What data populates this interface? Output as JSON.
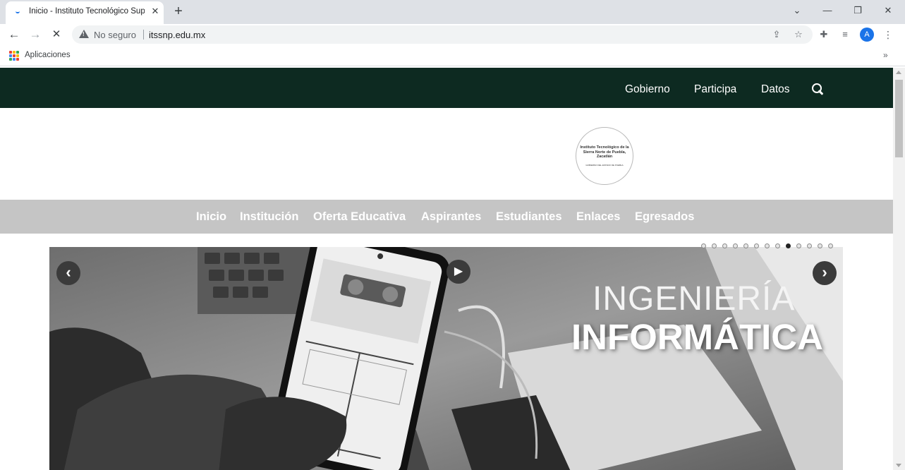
{
  "browser": {
    "tab_title": "Inicio - Instituto Tecnológico Sup",
    "tab_close": "✕",
    "new_tab": "+",
    "window": {
      "minimize": "—",
      "restore": "❐",
      "close": "✕",
      "tab_search": "⌄"
    },
    "nav": {
      "back": "←",
      "forward": "→",
      "stop": "✕"
    },
    "security_label": "No seguro",
    "url": "itssnp.edu.mx",
    "toolbar_icons": [
      "share-icon",
      "star-icon",
      "extensions-icon",
      "reading-list-icon",
      "profile-avatar",
      "menu-icon"
    ],
    "profile_initial": "A",
    "bookmarks": {
      "apps_label": "Aplicaciones",
      "more": "»"
    }
  },
  "gov_bar": {
    "links": [
      "Gobierno",
      "Participa",
      "Datos"
    ]
  },
  "logo": {
    "name": "Instituto Tecnológico de la Sierra Norte de Puebla, Zacatlán",
    "subtext": "GOBIERNO DEL ESTADO DE PUEBLA"
  },
  "main_nav": {
    "items": [
      "Inicio",
      "Institución",
      "Oferta Educativa",
      "Aspirantes",
      "Estudiantes",
      "Enlaces",
      "Egresados"
    ]
  },
  "slider": {
    "title_line1": "INGENIERÍA",
    "title_line2": "INFORMÁTICA",
    "prev": "‹",
    "next": "›",
    "play": "▶",
    "slide_count": 13,
    "active_slide": 8
  },
  "colors": {
    "gov_bar_bg": "#0d2a21",
    "main_nav_bg": "#c5c5c5",
    "accent_blue": "#1a73e8"
  }
}
